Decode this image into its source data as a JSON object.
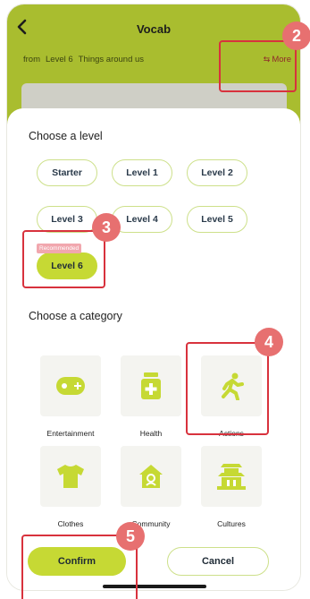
{
  "header": {
    "title": "Vocab",
    "from_label": "from",
    "level": "Level 6",
    "topic": "Things around us",
    "more_label": "More",
    "more_icon": "swap-arrows-icon"
  },
  "level_section": {
    "title": "Choose a level",
    "levels": [
      "Starter",
      "Level 1",
      "Level 2",
      "Level 3",
      "Level 4",
      "Level 5",
      "Level 6"
    ],
    "selected": "Level 6",
    "recommended_tag": "Recommended"
  },
  "category_section": {
    "title": "Choose a category",
    "categories": [
      {
        "label": "Entertainment",
        "icon": "gamepad-icon"
      },
      {
        "label": "Health",
        "icon": "medicine-jar-icon"
      },
      {
        "label": "Actions",
        "icon": "running-person-icon"
      },
      {
        "label": "Clothes",
        "icon": "tshirt-icon"
      },
      {
        "label": "Community",
        "icon": "community-building-icon"
      },
      {
        "label": "Cultures",
        "icon": "temple-icon"
      }
    ]
  },
  "buttons": {
    "confirm": "Confirm",
    "cancel": "Cancel"
  },
  "annotations": [
    "2",
    "3",
    "4",
    "5"
  ],
  "colors": {
    "accent": "#c6d934",
    "header_bg": "#a9bd2f",
    "annotation": "#d8323d",
    "badge": "#e77070"
  }
}
